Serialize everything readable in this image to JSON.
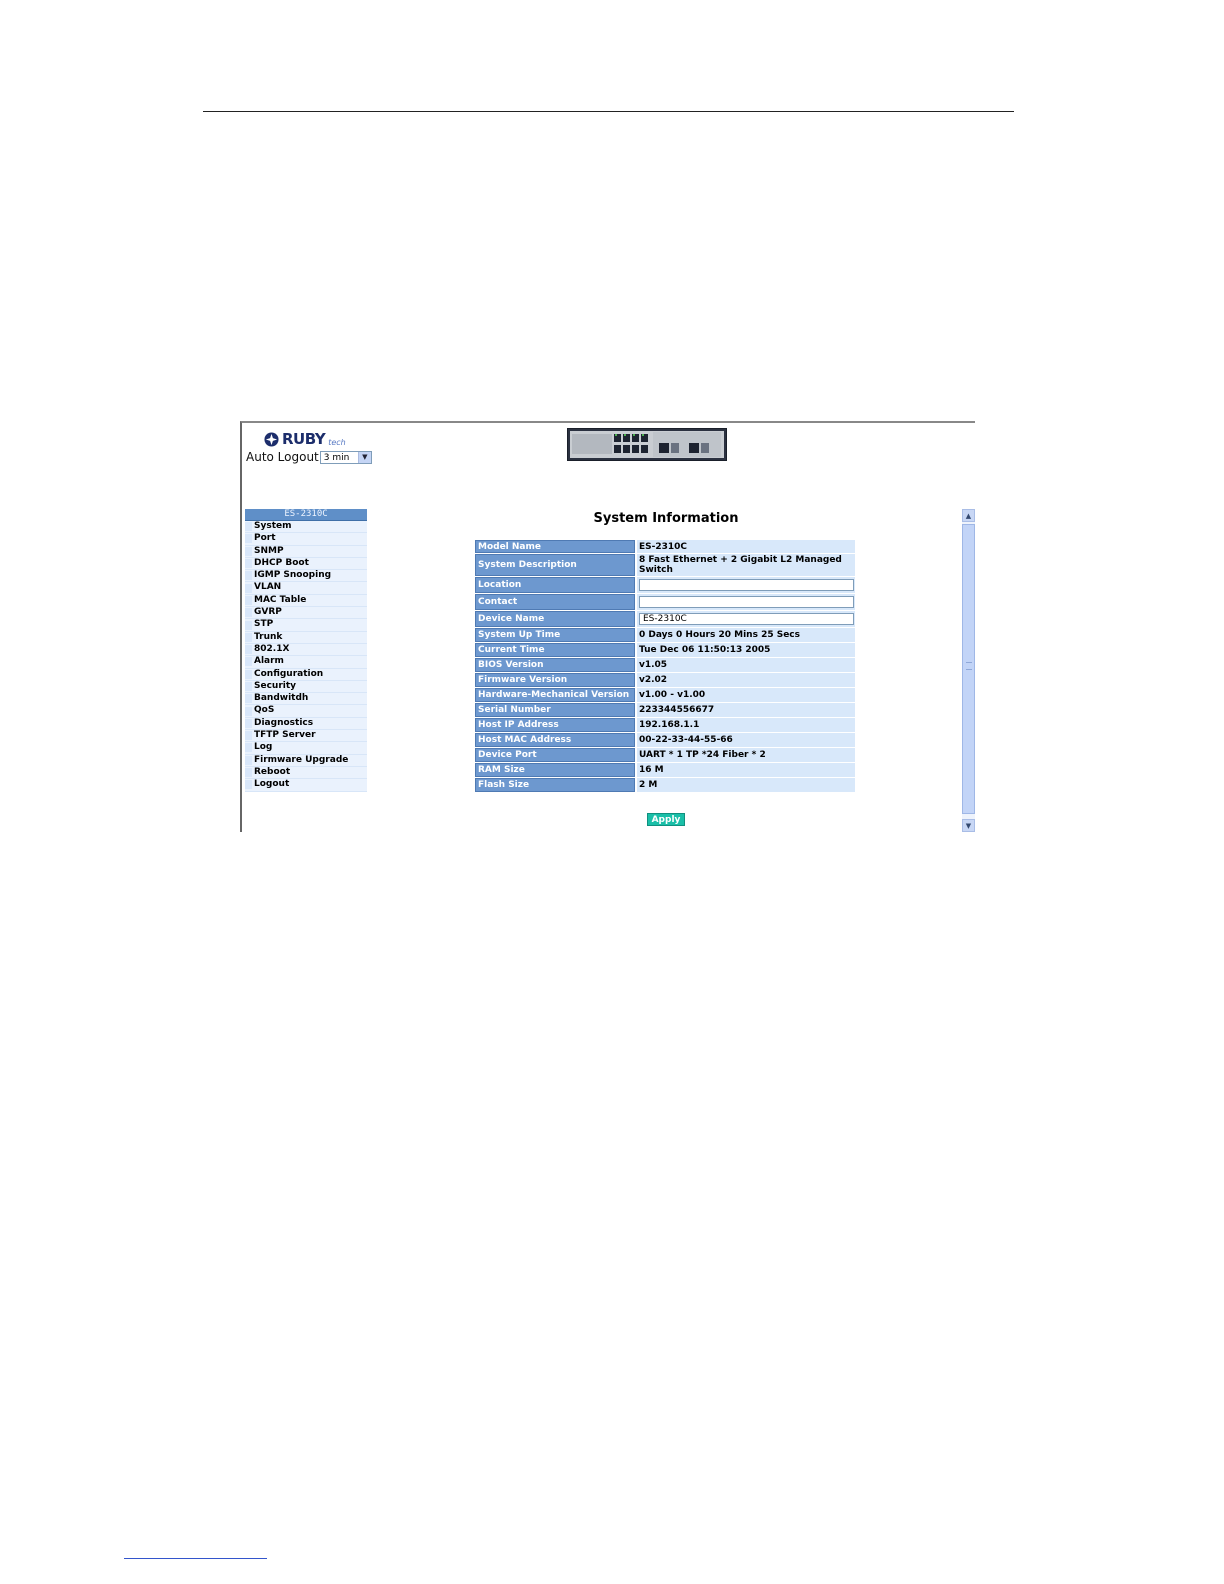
{
  "logo": {
    "text": "RUBY",
    "sub": "tech"
  },
  "auto_logout": {
    "label": "Auto Logout",
    "value": "3 min"
  },
  "sidebar": {
    "header": "ES-2310C",
    "items": [
      "System",
      "Port",
      "SNMP",
      "DHCP Boot",
      "IGMP Snooping",
      "VLAN",
      "MAC Table",
      "GVRP",
      "STP",
      "Trunk",
      "802.1X",
      "Alarm",
      "Configuration",
      "Security",
      "Bandwitdh",
      "QoS",
      "Diagnostics",
      "TFTP Server",
      "Log",
      "Firmware Upgrade",
      "Reboot",
      "Logout"
    ]
  },
  "main": {
    "title": "System Information",
    "rows": [
      {
        "label": "Model Name",
        "value": "ES-2310C",
        "type": "text"
      },
      {
        "label": "System Description",
        "value": "8 Fast Ethernet + 2 Gigabit L2 Managed Switch",
        "type": "text"
      },
      {
        "label": "Location",
        "value": "",
        "type": "input"
      },
      {
        "label": "Contact",
        "value": "",
        "type": "input"
      },
      {
        "label": "Device Name",
        "value": "ES-2310C",
        "type": "input"
      },
      {
        "label": "System Up Time",
        "value": "0 Days 0 Hours 20 Mins 25 Secs",
        "type": "text"
      },
      {
        "label": "Current Time",
        "value": "Tue Dec 06 11:50:13 2005",
        "type": "text"
      },
      {
        "label": "BIOS Version",
        "value": "v1.05",
        "type": "text"
      },
      {
        "label": "Firmware Version",
        "value": "v2.02",
        "type": "text"
      },
      {
        "label": "Hardware-Mechanical Version",
        "value": "v1.00 - v1.00",
        "type": "text"
      },
      {
        "label": "Serial Number",
        "value": "223344556677",
        "type": "text"
      },
      {
        "label": "Host IP Address",
        "value": "192.168.1.1",
        "type": "text"
      },
      {
        "label": "Host MAC Address",
        "value": "00-22-33-44-55-66",
        "type": "text"
      },
      {
        "label": "Device Port",
        "value": "UART * 1 TP *24 Fiber * 2",
        "type": "text"
      },
      {
        "label": "RAM Size",
        "value": "16 M",
        "type": "text"
      },
      {
        "label": "Flash Size",
        "value": "2 M",
        "type": "text"
      }
    ],
    "apply_label": "Apply"
  },
  "colors": {
    "label_bg": "#6d98cf",
    "value_bg": "#d8e8fa",
    "sidebar_header_bg": "#5f8fc8",
    "apply_bg": "#1abfa8"
  },
  "icons": [
    "ruby-logo-icon",
    "chevron-down-icon",
    "switch-device-icon",
    "scroll-up-icon",
    "scroll-down-icon"
  ]
}
